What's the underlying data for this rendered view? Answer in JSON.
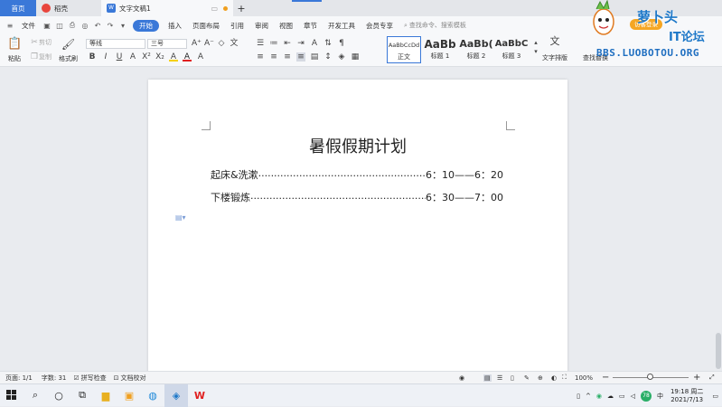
{
  "titlebar": {
    "home_tab": "首页",
    "docer_tab": "稻壳",
    "doc_tab": "文字文稿1",
    "plus": "+"
  },
  "menubar": {
    "file": "文件",
    "items": [
      "开始",
      "插入",
      "页面布局",
      "引用",
      "审阅",
      "视图",
      "章节",
      "开发工具",
      "会员专享"
    ],
    "search_placeholder": "查找命令、搜索模板",
    "login_badge": "访客登录"
  },
  "ribbon": {
    "paste": "粘贴",
    "cut": "剪切",
    "copy": "复制",
    "format_painter": "格式刷",
    "font_name": "等线",
    "font_size": "三号",
    "styles": [
      {
        "preview": "AaBbCcDd",
        "name": "正文"
      },
      {
        "preview": "AaBb",
        "name": "标题 1"
      },
      {
        "preview": "AaBb(",
        "name": "标题 2"
      },
      {
        "preview": "AaBbC",
        "name": "标题 3"
      }
    ],
    "text_layout": "文字排版",
    "find_replace": "查找替换"
  },
  "watermark": {
    "site_name": "萝卜头",
    "forum": "IT论坛",
    "url": "BBS.LUOBOTOU.ORG"
  },
  "document": {
    "title": "暑假假期计划",
    "lines": [
      {
        "label": "起床&洗漱",
        "dots": "...............................................................................",
        "time": "6：10——6：20"
      },
      {
        "label": "下楼锻炼",
        "dots": "...............................................................................",
        "time": "6：30——7：00"
      }
    ]
  },
  "statusbar": {
    "page": "页面: 1/1",
    "words": "字数: 31",
    "spellcheck": "拼写检查",
    "doc_proof": "文档校对",
    "zoom": "100%"
  },
  "taskbar": {
    "time": "19:18 周二",
    "date": "2021/7/13",
    "ime": "中",
    "badge": "78"
  }
}
